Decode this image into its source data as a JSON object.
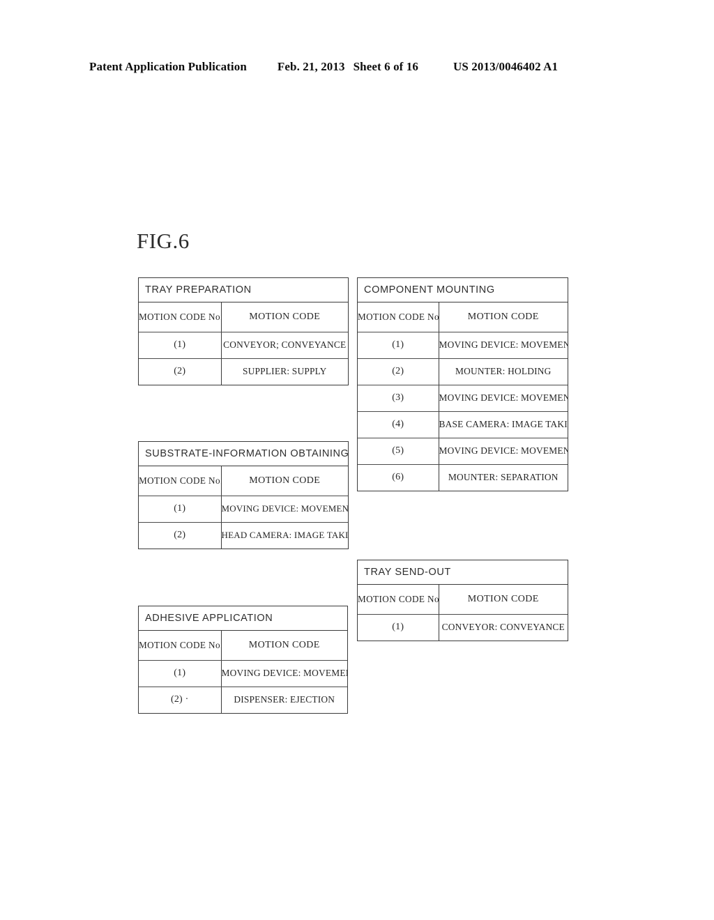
{
  "page_header": {
    "publication": "Patent Application Publication",
    "date": "Feb. 21, 2013",
    "sheet": "Sheet 6 of 16",
    "document_number": "US 2013/0046402 A1"
  },
  "figure": {
    "label": "FIG.6"
  },
  "columns": {
    "code_no": "MOTION CODE No.",
    "code": "MOTION CODE"
  },
  "tables": [
    {
      "id": "tray-preparation",
      "title": "TRAY PREPARATION",
      "rows": [
        {
          "no": "(1)",
          "code": "CONVEYOR; CONVEYANCE"
        },
        {
          "no": "(2)",
          "code": "SUPPLIER: SUPPLY"
        }
      ]
    },
    {
      "id": "component-mounting",
      "title": "COMPONENT MOUNTING",
      "rows": [
        {
          "no": "(1)",
          "code": "MOVING DEVICE: MOVEMENT"
        },
        {
          "no": "(2)",
          "code": "MOUNTER: HOLDING"
        },
        {
          "no": "(3)",
          "code": "MOVING DEVICE: MOVEMENT"
        },
        {
          "no": "(4)",
          "code": "BASE CAMERA: IMAGE TAKING"
        },
        {
          "no": "(5)",
          "code": "MOVING DEVICE: MOVEMENT"
        },
        {
          "no": "(6)",
          "code": "MOUNTER: SEPARATION"
        }
      ]
    },
    {
      "id": "substrate-information",
      "title": "SUBSTRATE-INFORMATION OBTAINING",
      "rows": [
        {
          "no": "(1)",
          "code": "MOVING DEVICE: MOVEMENT"
        },
        {
          "no": "(2)",
          "code": "HEAD CAMERA: IMAGE TAKING"
        }
      ]
    },
    {
      "id": "adhesive-application",
      "title": "ADHESIVE APPLICATION",
      "rows": [
        {
          "no": "(1)",
          "code": "MOVING DEVICE: MOVEMENT"
        },
        {
          "no": "(2) ·",
          "code": "DISPENSER: EJECTION"
        }
      ]
    },
    {
      "id": "tray-send-out",
      "title": "TRAY SEND-OUT",
      "rows": [
        {
          "no": "(1)",
          "code": "CONVEYOR: CONVEYANCE"
        }
      ]
    }
  ]
}
